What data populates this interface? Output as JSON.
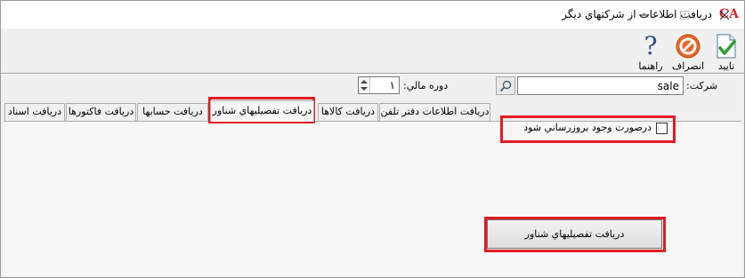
{
  "window": {
    "title": "دريافت اطلاعات از شرکتهاي ديگر",
    "app_icon_text": "CA",
    "minimize_icon": "minimize-icon",
    "maximize_icon": "maximize-icon",
    "close_icon": "close-icon"
  },
  "toolbar": {
    "confirm_label": "تاييد",
    "cancel_label": "انصراف",
    "help_label": "راهنما",
    "help_glyph": "?"
  },
  "filters": {
    "company_label": "شرکت:",
    "company_value": "sale",
    "period_label": "دوره مالي:",
    "period_value": "۱"
  },
  "tabs": [
    {
      "label": "دريافت اطلاعات دفتر تلفن"
    },
    {
      "label": "دريافت کالاها"
    },
    {
      "label": "دريافت تفصيليهاي شناور"
    },
    {
      "label": "دريافت حسابها"
    },
    {
      "label": "دريافت فاکتورها"
    },
    {
      "label": "دريافت اسناد"
    }
  ],
  "active_tab": "دريافت تفصيليهاي شناور",
  "panel": {
    "update_checkbox_label": "درصورت وجود بروزرساني شود",
    "update_checkbox_checked": false,
    "action_button_label": "دريافت تفصيليهاي شناور"
  },
  "colors": {
    "highlight": "#e31b23",
    "cancel_icon": "#e5662a",
    "confirm_check": "#2f9e2f",
    "help_icon": "#2a4d8f"
  }
}
